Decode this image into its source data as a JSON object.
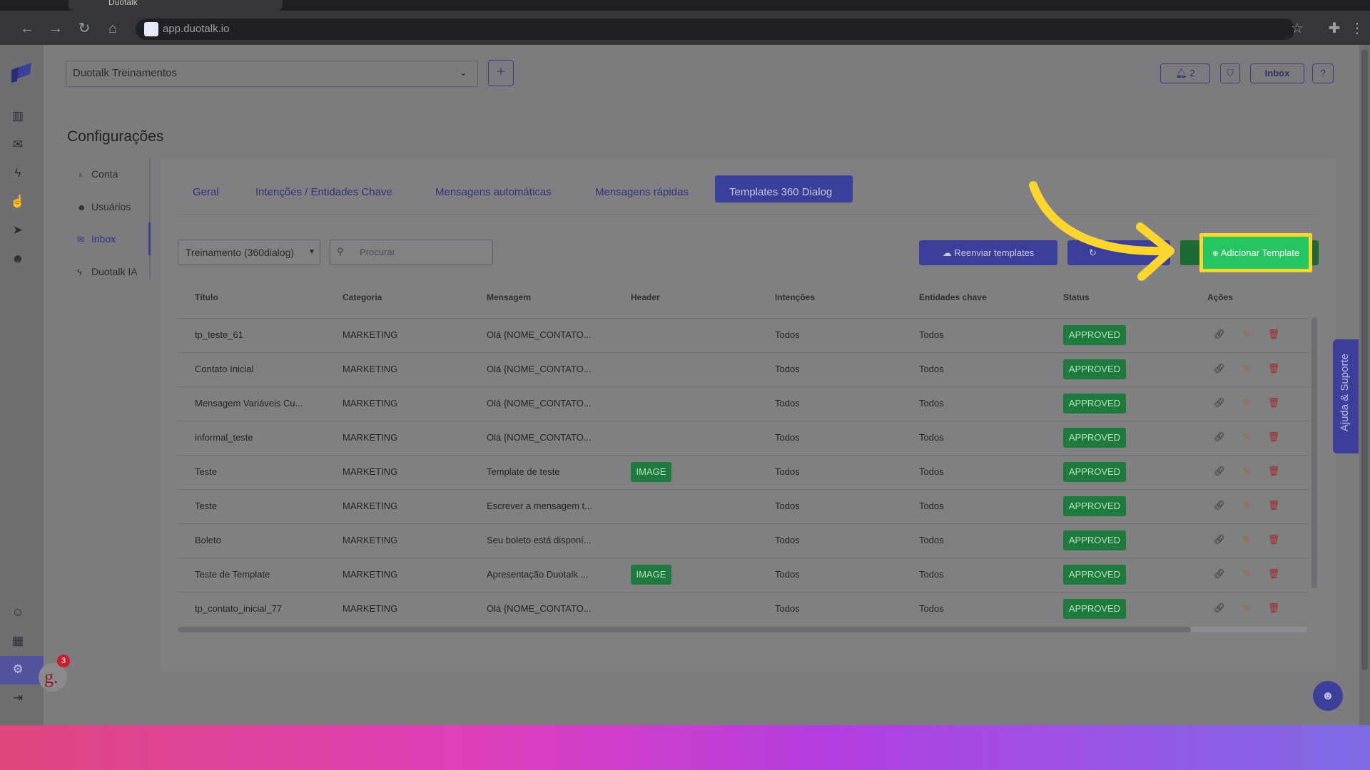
{
  "browser": {
    "tab_title": "Duotalk",
    "url": "app.duotalk.io"
  },
  "header": {
    "company": "Duotalk Treinamentos",
    "notifications_label": "2",
    "inbox_label": "Inbox",
    "help_label": "?"
  },
  "page": {
    "title": "Configurações"
  },
  "menu": {
    "items": [
      {
        "label": "Conta"
      },
      {
        "label": "Usuários"
      },
      {
        "label": "Inbox"
      },
      {
        "label": "Duotalk IA"
      }
    ]
  },
  "tabs": [
    {
      "label": "Geral"
    },
    {
      "label": "Intenções / Entidades Chave"
    },
    {
      "label": "Mensagens automáticas"
    },
    {
      "label": "Mensagens rápidas"
    },
    {
      "label": "Templates 360 Dialog"
    }
  ],
  "filters": {
    "channel": "Treinamento (360dialog)",
    "search_placeholder": "Procurar"
  },
  "actions": {
    "resend": "Reenviar templates",
    "add": "Adicionar Template"
  },
  "table": {
    "headers": [
      "Título",
      "Categoria",
      "Mensagem",
      "Header",
      "Intenções",
      "Entidades chave",
      "Status",
      "Ações"
    ],
    "rows": [
      {
        "title": "tp_teste_61",
        "category": "MARKETING",
        "message": "Olá {NOME_CONTATO...",
        "header": "",
        "intents": "Todos",
        "entities": "Todos",
        "status": "APPROVED"
      },
      {
        "title": "Contato Inicial",
        "category": "MARKETING",
        "message": "Olá {NOME_CONTATO...",
        "header": "",
        "intents": "Todos",
        "entities": "Todos",
        "status": "APPROVED"
      },
      {
        "title": "Mensagem Variáveis Cu...",
        "category": "MARKETING",
        "message": "Olá {NOME_CONTATO...",
        "header": "",
        "intents": "Todos",
        "entities": "Todos",
        "status": "APPROVED"
      },
      {
        "title": "informal_teste",
        "category": "MARKETING",
        "message": "Olá {NOME_CONTATO...",
        "header": "",
        "intents": "Todos",
        "entities": "Todos",
        "status": "APPROVED"
      },
      {
        "title": "Teste",
        "category": "MARKETING",
        "message": "Template de teste",
        "header": "IMAGE",
        "intents": "Todos",
        "entities": "Todos",
        "status": "APPROVED"
      },
      {
        "title": "Teste",
        "category": "MARKETING",
        "message": "Escrever a mensagem t...",
        "header": "",
        "intents": "Todos",
        "entities": "Todos",
        "status": "APPROVED"
      },
      {
        "title": "Boleto",
        "category": "MARKETING",
        "message": "Seu boleto está disponí...",
        "header": "",
        "intents": "Todos",
        "entities": "Todos",
        "status": "APPROVED"
      },
      {
        "title": "Teste de Template",
        "category": "MARKETING",
        "message": "Apresentação Duotalk ...",
        "header": "IMAGE",
        "intents": "Todos",
        "entities": "Todos",
        "status": "APPROVED"
      },
      {
        "title": "tp_contato_inicial_77",
        "category": "MARKETING",
        "message": "Olá {NOME_CONTATO...",
        "header": "",
        "intents": "Todos",
        "entities": "Todos",
        "status": "APPROVED"
      }
    ]
  },
  "support": {
    "help_label": "Ajuda & Suporte",
    "avatar_badge": "3"
  },
  "colors": {
    "primary": "#3b3f9a",
    "success": "#1e7b3d",
    "highlight": "#fcd62e",
    "add_button": "#22c55e"
  }
}
